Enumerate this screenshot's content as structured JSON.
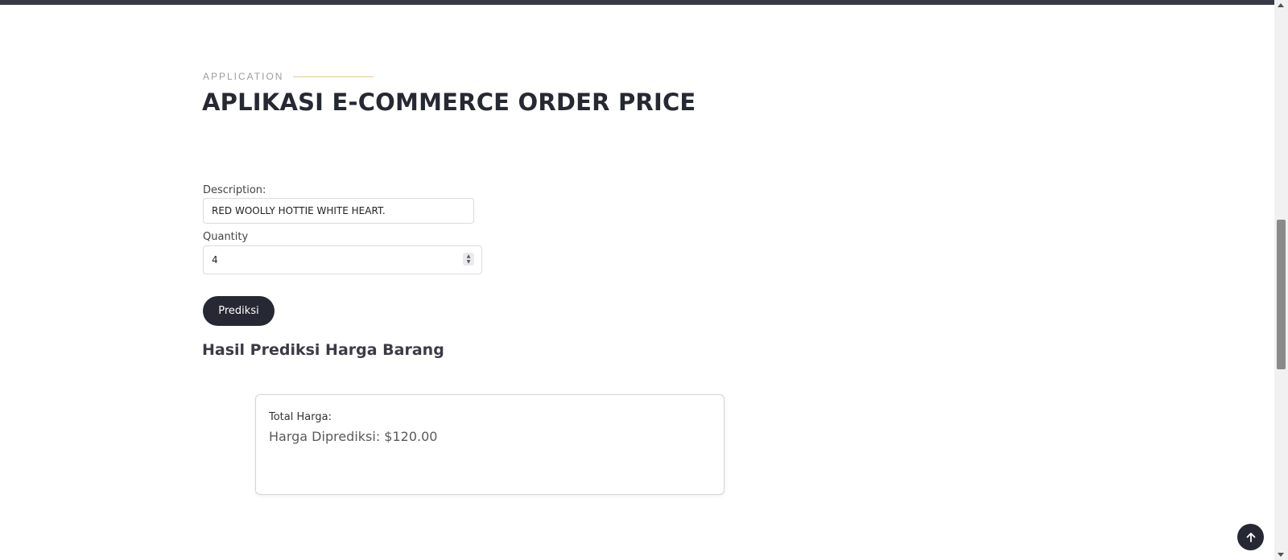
{
  "header": {
    "eyebrow": "APPLICATION",
    "title": "APLIKASI E-COMMERCE ORDER PRICE"
  },
  "form": {
    "description_label": "Description:",
    "description_value": "RED WOOLLY HOTTIE WHITE HEART.",
    "quantity_label": "Quantity",
    "quantity_value": "4",
    "submit_label": "Prediksi"
  },
  "result": {
    "heading": "Hasil Prediksi Harga Barang",
    "total_label": "Total Harga:",
    "predicted_text": "Harga Diprediksi: $120.00"
  },
  "icons": {
    "back_to_top": "arrow-up-icon",
    "stepper": "spinner-arrows-icon"
  },
  "colors": {
    "top_bar": "#373a44",
    "primary_dark": "#262833",
    "eyebrow_accent": "#e5c98a"
  }
}
